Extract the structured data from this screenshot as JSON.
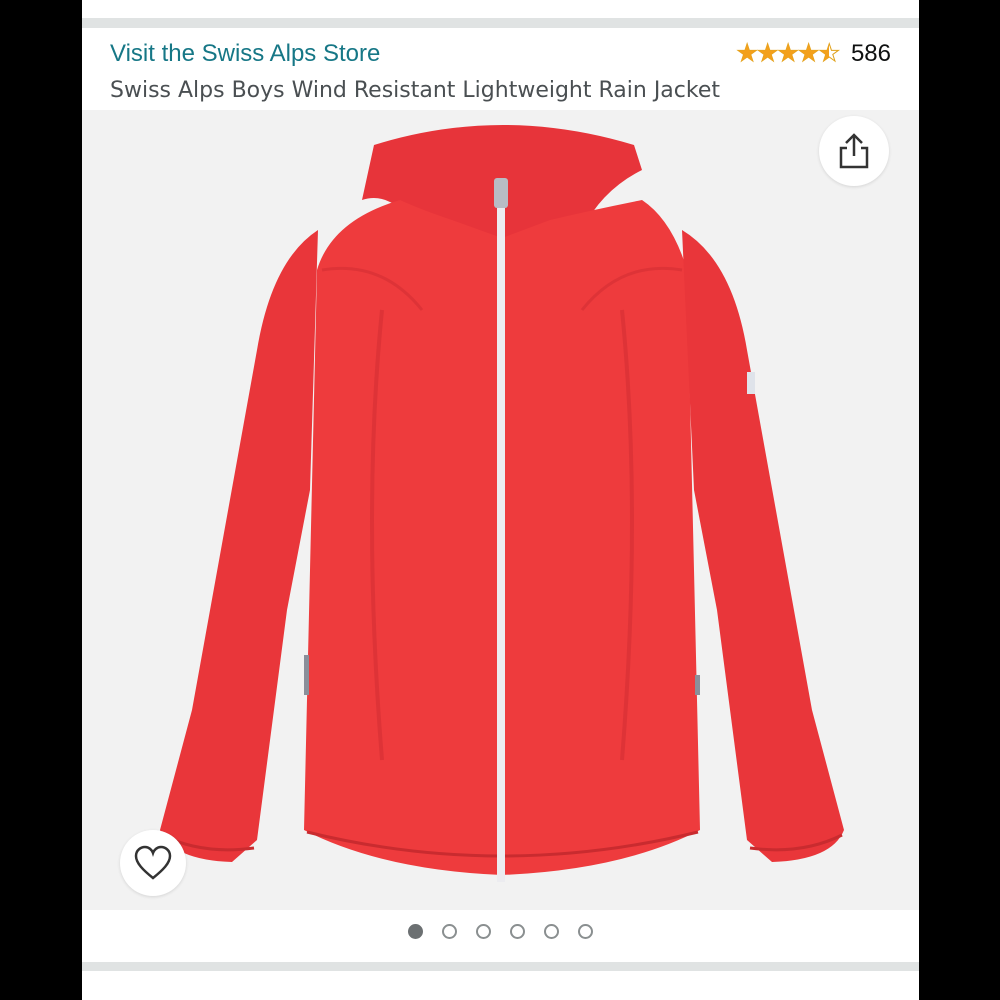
{
  "store": {
    "link_label": "Visit the Swiss Alps Store",
    "link_color": "#167786"
  },
  "rating": {
    "stars": 4.5,
    "count": "586",
    "star_color": "#f3a01c"
  },
  "product": {
    "title": "Swiss Alps Boys Wind Resistant Lightweight Rain Jacket"
  },
  "image": {
    "subject": "red hooded rain jacket with white zipper",
    "jacket_color": "#ee3a3c"
  },
  "actions": {
    "share_icon": "share-icon",
    "favorite_icon": "heart-outline-icon"
  },
  "carousel": {
    "total": 6,
    "active_index": 1
  }
}
